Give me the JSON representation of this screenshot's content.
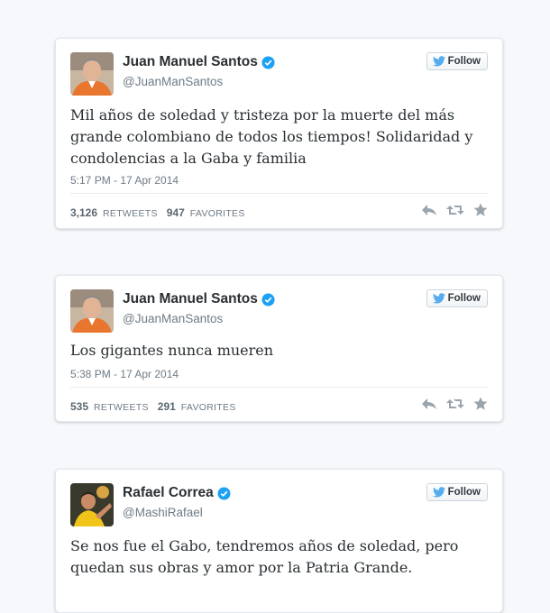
{
  "tweets": [
    {
      "name": "Juan Manuel Santos",
      "handle": "@JuanManSantos",
      "follow_label": "Follow",
      "text": "Mil años de soledad y tristeza por la muerte del más grande colombiano de todos los tiempos! Solidaridad y condolencias a la Gaba y familia",
      "timestamp": "5:17 PM - 17 Apr 2014",
      "retweets": "3,126",
      "retweets_label": "RETWEETS",
      "favorites": "947",
      "favorites_label": "FAVORITES"
    },
    {
      "name": "Juan Manuel Santos",
      "handle": "@JuanManSantos",
      "follow_label": "Follow",
      "text": "Los gigantes nunca mueren",
      "timestamp": "5:38 PM - 17 Apr 2014",
      "retweets": "535",
      "retweets_label": "RETWEETS",
      "favorites": "291",
      "favorites_label": "FAVORITES"
    },
    {
      "name": "Rafael Correa",
      "handle": "@MashiRafael",
      "follow_label": "Follow",
      "text": "Se nos fue el Gabo, tendremos años de soledad, pero quedan sus obras y amor por la Patria Grande."
    }
  ],
  "icons": {
    "verified": "verified-badge-icon",
    "follow": "twitter-bird-icon",
    "reply": "reply-icon",
    "retweet": "retweet-icon",
    "favorite": "star-icon"
  },
  "colors": {
    "verified_blue": "#1da1f2",
    "twitter_blue": "#55acee",
    "text": "#292f33",
    "muted": "#6e7b86",
    "action_icon": "#99a4ad"
  }
}
